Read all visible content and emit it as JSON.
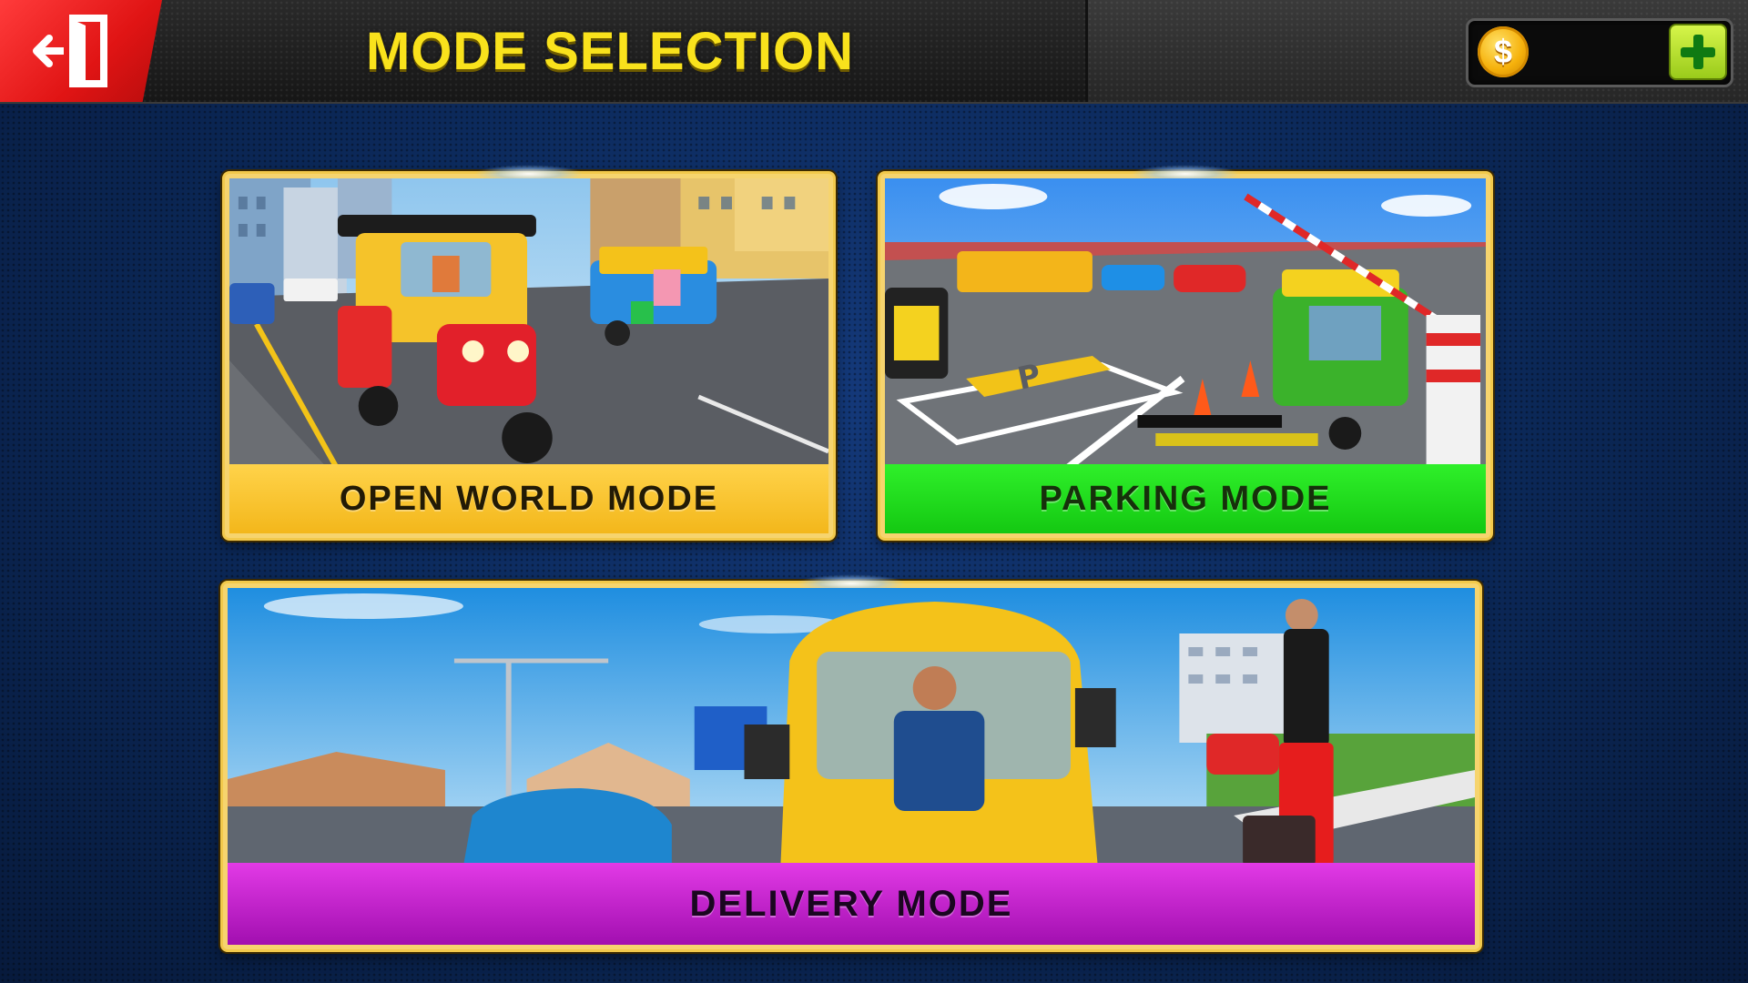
{
  "header": {
    "title": "MODE SELECTION",
    "exit_icon": "exit-door-icon"
  },
  "currency": {
    "icon": "coin-icon",
    "symbol": "$",
    "value": "",
    "add_icon": "plus-icon"
  },
  "modes": [
    {
      "label": "OPEN WORLD MODE",
      "color": "#f3b71b",
      "scene": "city street with rickshaws"
    },
    {
      "label": "PARKING MODE",
      "color": "#14c812",
      "scene": "parking lot with cones and barrier"
    },
    {
      "label": "DELIVERY MODE",
      "color": "#a20fb0",
      "scene": "rickshaw driver with passenger"
    }
  ],
  "colors": {
    "title_yellow": "#f9e21c",
    "exit_red": "#e01414",
    "add_green": "#9acb1b",
    "card_border": "#f2c94c"
  }
}
